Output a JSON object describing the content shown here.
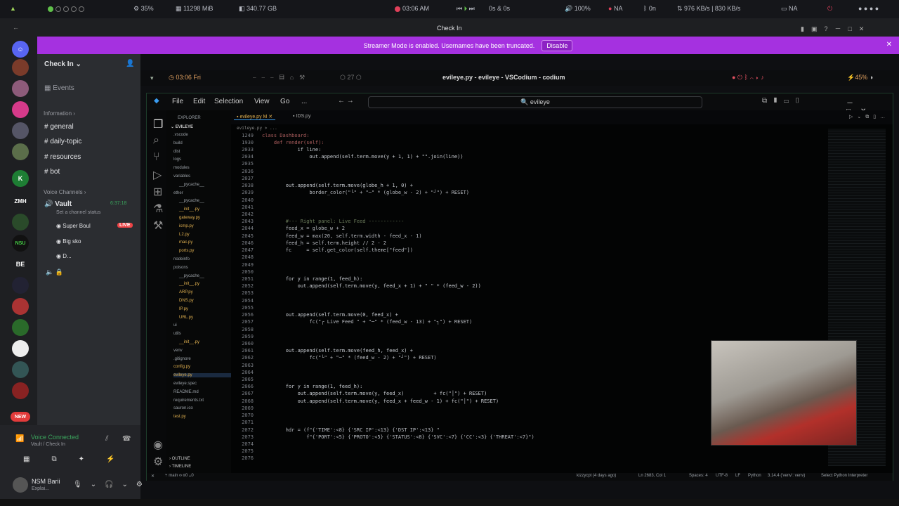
{
  "os": {
    "items": [
      "35%",
      "11298 MiB",
      "340.77 GB",
      "03:06 AM",
      "0s & 0s",
      "100%",
      "NA",
      "0n",
      "976 KB/s | 830 KB/s",
      "NA"
    ]
  },
  "discord": {
    "title": "Check In",
    "banner_text": "Streamer Mode is enabled. Usernames have been truncated.",
    "banner_button": "Disable",
    "server": "Check In",
    "events": "Events",
    "info_cat": "Information",
    "channels": [
      "general",
      "daily-topic",
      "resources",
      "bot"
    ],
    "voice_cat": "Voice Channels",
    "voice_channel": "Vault",
    "voice_time": "6:37:18",
    "voice_status": "Set a channel status",
    "members": [
      {
        "name": "Super Boul",
        "badge": "LIVE"
      },
      {
        "name": "Big sko"
      },
      {
        "name": "D..."
      }
    ],
    "rail": [
      "ZMH",
      "NSU",
      "BE",
      "NEW"
    ],
    "voice_connected": "Voice Connected",
    "voice_sub": "Vault / Check In",
    "user_name": "NSM Barii",
    "user_sub": "Explai..."
  },
  "wm": {
    "time": "03:06 Fri",
    "workspace": "27",
    "window_title": "evileye.py - evileye - VSCodium - codium",
    "battery": "45%"
  },
  "vscode": {
    "menu": [
      "File",
      "Edit",
      "Selection",
      "View",
      "Go",
      "..."
    ],
    "search": "evileye",
    "explorer_title": "EXPLORER",
    "project": "EVILEYE",
    "tabs": [
      "evileye.py M",
      "IDS.py"
    ],
    "breadcrumb": "evileye.py > ...",
    "sticky": [
      {
        "ln": "1249",
        "code": "class Dashboard:"
      },
      {
        "ln": "1930",
        "code": "    def render(self):"
      }
    ],
    "files": [
      ".vscode",
      "build",
      "dist",
      "logs",
      "modules",
      "variables",
      "__pycache__",
      "ether",
      "__pycache__",
      "__init__.py",
      "gateway.py",
      "icmp.py",
      "L2.py",
      "mac.py",
      "ports.py",
      "nodeinfo",
      "poisons",
      "__pycache__",
      "__init__.py",
      "ARP.py",
      "DNS.py",
      "IP.py",
      "URL.py",
      "ui",
      "utils",
      "__init__.py",
      "venv",
      ".gitignore",
      "config.py",
      "evileye.py",
      "evileye.spec",
      "README.md",
      "requirements.txt",
      "sauron.ico",
      "test.py"
    ],
    "lines": [
      {
        "n": "2033",
        "c": "            if line:"
      },
      {
        "n": "2034",
        "c": "                out.append(self.term.move(y + 1, 1) + \"\".join(line))"
      },
      {
        "n": "2035",
        "c": ""
      },
      {
        "n": "2036",
        "c": ""
      },
      {
        "n": "2037",
        "c": ""
      },
      {
        "n": "2038",
        "c": "        out.append(self.term.move(globe_h + 1, 0) +"
      },
      {
        "n": "2039",
        "c": "                border_color(\"└\" + \"─\" * (globe_w - 2) + \"┘\") + RESET)"
      },
      {
        "n": "2040",
        "c": ""
      },
      {
        "n": "2041",
        "c": ""
      },
      {
        "n": "2042",
        "c": ""
      },
      {
        "n": "2043",
        "c": "        #--- Right panel: Live Feed ------------"
      },
      {
        "n": "2044",
        "c": "        feed_x = globe_w + 2"
      },
      {
        "n": "2045",
        "c": "        feed_w = max(20, self.term.width - feed_x - 1)"
      },
      {
        "n": "2046",
        "c": "        feed_h = self.term.height // 2 - 2"
      },
      {
        "n": "2047",
        "c": "        fc     = self.get_color(self.theme[\"feed\"])"
      },
      {
        "n": "2048",
        "c": ""
      },
      {
        "n": "2049",
        "c": ""
      },
      {
        "n": "2050",
        "c": ""
      },
      {
        "n": "2051",
        "c": "        for y in range(1, feed_h):"
      },
      {
        "n": "2052",
        "c": "            out.append(self.term.move(y, feed_x + 1) + \" \" * (feed_w - 2))"
      },
      {
        "n": "2053",
        "c": ""
      },
      {
        "n": "2054",
        "c": ""
      },
      {
        "n": "2055",
        "c": ""
      },
      {
        "n": "2056",
        "c": "        out.append(self.term.move(0, feed_x) +"
      },
      {
        "n": "2057",
        "c": "                fc(\"┌ Live Feed \" + \"─\" * (feed_w - 13) + \"┐\") + RESET)"
      },
      {
        "n": "2058",
        "c": ""
      },
      {
        "n": "2059",
        "c": ""
      },
      {
        "n": "2060",
        "c": ""
      },
      {
        "n": "2061",
        "c": "        out.append(self.term.move(feed_h, feed_x) +"
      },
      {
        "n": "2062",
        "c": "                fc(\"└\" + \"─\" * (feed_w - 2) + \"┘\") + RESET)"
      },
      {
        "n": "2063",
        "c": ""
      },
      {
        "n": "2064",
        "c": ""
      },
      {
        "n": "2065",
        "c": ""
      },
      {
        "n": "2066",
        "c": "        for y in range(1, feed_h):"
      },
      {
        "n": "2067",
        "c": "            out.append(self.term.move(y, feed_x)          + fc(\"│\") + RESET)"
      },
      {
        "n": "2068",
        "c": "            out.append(self.term.move(y, feed_x + feed_w - 1) + fc(\"│\") + RESET)"
      },
      {
        "n": "2069",
        "c": ""
      },
      {
        "n": "2070",
        "c": ""
      },
      {
        "n": "2071",
        "c": ""
      },
      {
        "n": "2072",
        "c": "        hdr = (f\"{'TIME':<8} {'SRC IP':<13} {'DST IP':<13} \""
      },
      {
        "n": "2073",
        "c": "               f\"{'PORT':<5} {'PROTO':<5} {'STATUS':<8} {'SVC':<7} {'CC':<3} {'THREAT':<7}\")"
      },
      {
        "n": "2074",
        "c": ""
      },
      {
        "n": "2075",
        "c": ""
      },
      {
        "n": "2076",
        "c": ""
      }
    ],
    "outline": "OUTLINE",
    "timeline": "TIMELINE",
    "status": {
      "branch": "main",
      "blame": "kizzycpt (4 days ago)",
      "pos": "Ln 2683, Col 1",
      "spaces": "Spaces: 4",
      "enc": "UTF-8",
      "eol": "LF",
      "lang": "Python",
      "interp": "3.14.4 ('venv': venv)",
      "select": "Select Python Interpreter"
    }
  }
}
